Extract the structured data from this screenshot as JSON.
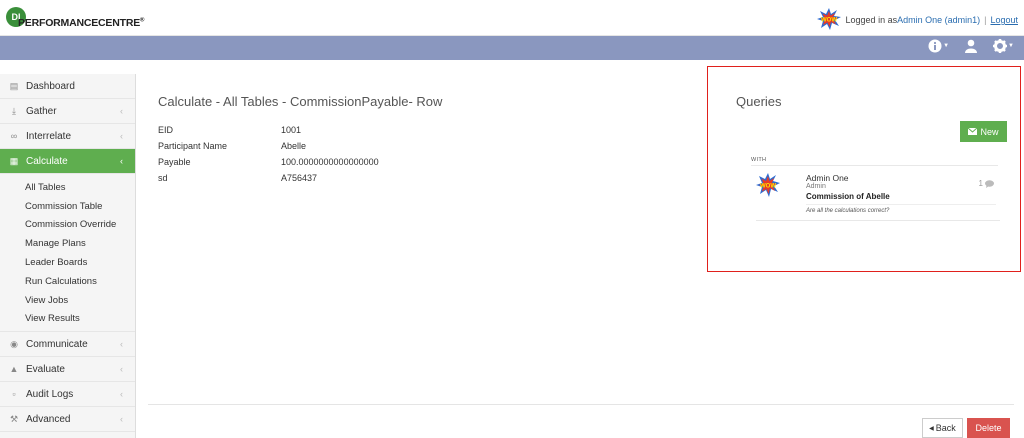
{
  "header": {
    "logo_mark": "DI",
    "logo_text": "PERFORMANCECENTRE",
    "logo_sup": "®",
    "logged_in_prefix": "Logged in as ",
    "user_link": "Admin One (admin1)",
    "separator": "|",
    "logout": "Logout",
    "avatar_text": "WOW"
  },
  "navbar": {
    "icons": [
      "info-icon",
      "user-icon",
      "gear-icon"
    ],
    "background": "#8a97bf"
  },
  "sidebar": {
    "items": [
      {
        "label": "Dashboard",
        "icon": "bar-chart-icon"
      },
      {
        "label": "Gather",
        "icon": "download-icon"
      },
      {
        "label": "Interrelate",
        "icon": "link-icon"
      },
      {
        "label": "Calculate",
        "icon": "table-icon"
      },
      {
        "label": "Communicate",
        "icon": "comments-icon"
      },
      {
        "label": "Evaluate",
        "icon": "thumbs-up-icon"
      },
      {
        "label": "Audit Logs",
        "icon": "file-icon"
      },
      {
        "label": "Advanced",
        "icon": "wrench-icon"
      }
    ],
    "submenu": [
      "All Tables",
      "Commission Table",
      "Commission Override",
      "Manage Plans",
      "Leader Boards",
      "Run Calculations",
      "View Jobs",
      "View Results"
    ],
    "active_color": "#5fae4f"
  },
  "main": {
    "title": "Calculate - All Tables - CommissionPayable- Row",
    "fields": [
      {
        "label": "EID",
        "value": "1001"
      },
      {
        "label": "Participant Name",
        "value": "Abelle"
      },
      {
        "label": "Payable",
        "value": "100.0000000000000000"
      },
      {
        "label": "sd",
        "value": "A756437"
      }
    ]
  },
  "queries": {
    "title": "Queries",
    "new_label": "New",
    "with_label": "WITH",
    "item": {
      "name": "Admin One",
      "role": "Admin",
      "subject": "Commission of Abelle",
      "message": "Are all the calculations correct?",
      "count": "1"
    },
    "highlight_color": "#e0201c"
  },
  "footer": {
    "back_label": "Back",
    "delete_label": "Delete",
    "delete_color": "#d9534f"
  }
}
